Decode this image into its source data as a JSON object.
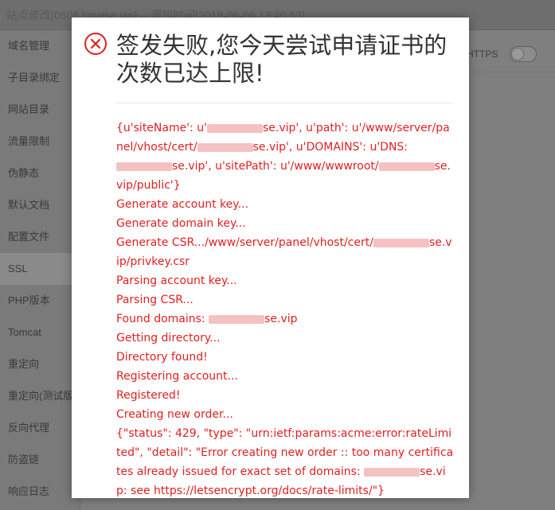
{
  "background": {
    "title": "站点修改[0606.hnwise.vip] -- 添加时间[2019-06-06 13:40:53]",
    "sidebar": [
      {
        "label": "域名管理"
      },
      {
        "label": "子目录绑定"
      },
      {
        "label": "网站目录"
      },
      {
        "label": "流量限制"
      },
      {
        "label": "伪静态"
      },
      {
        "label": "默认文档"
      },
      {
        "label": "配置文件"
      },
      {
        "label": "SSL",
        "active": true
      },
      {
        "label": "PHP版本"
      },
      {
        "label": "Tomcat"
      },
      {
        "label": "重定向"
      },
      {
        "label": "重定向(测试版)"
      },
      {
        "label": "反向代理"
      },
      {
        "label": "防盗链"
      },
      {
        "label": "响应日志"
      }
    ],
    "https_label": "HTTPS",
    "https_enabled": false
  },
  "dialog": {
    "icon": "error-circle-x-icon",
    "accent_color": "#e02020",
    "title": "签发失败,您今天尝试申请证书的次数已达上限!",
    "log": [
      "{u'siteName': u'[redacted]se.vip', u'path': u'/www/server/panel/vhost/cert/[redacted]se.vip', u'DOMAINS': u'DNS:[redacted]se.vip', u'sitePath': u'/www/wwwroot/[redacted]se.vip/public'}",
      "Generate account key...",
      "Generate domain key...",
      "Generate CSR.../www/server/panel/vhost/cert/[redacted]se.vip/privkey.csr",
      "Parsing account key...",
      "Parsing CSR...",
      "Found domains: [redacted]se.vip",
      "Getting directory...",
      "Directory found!",
      "Registering account...",
      "Registered!",
      "Creating new order...",
      "{\"status\": 429, \"type\": \"urn:ietf:params:acme:error:rateLimited\", \"detail\": \"Error creating new order :: too many certificates already issued for exact set of domains: [redacted]se.vip: see https://letsencrypt.org/docs/rate-limits/\"}"
    ]
  }
}
